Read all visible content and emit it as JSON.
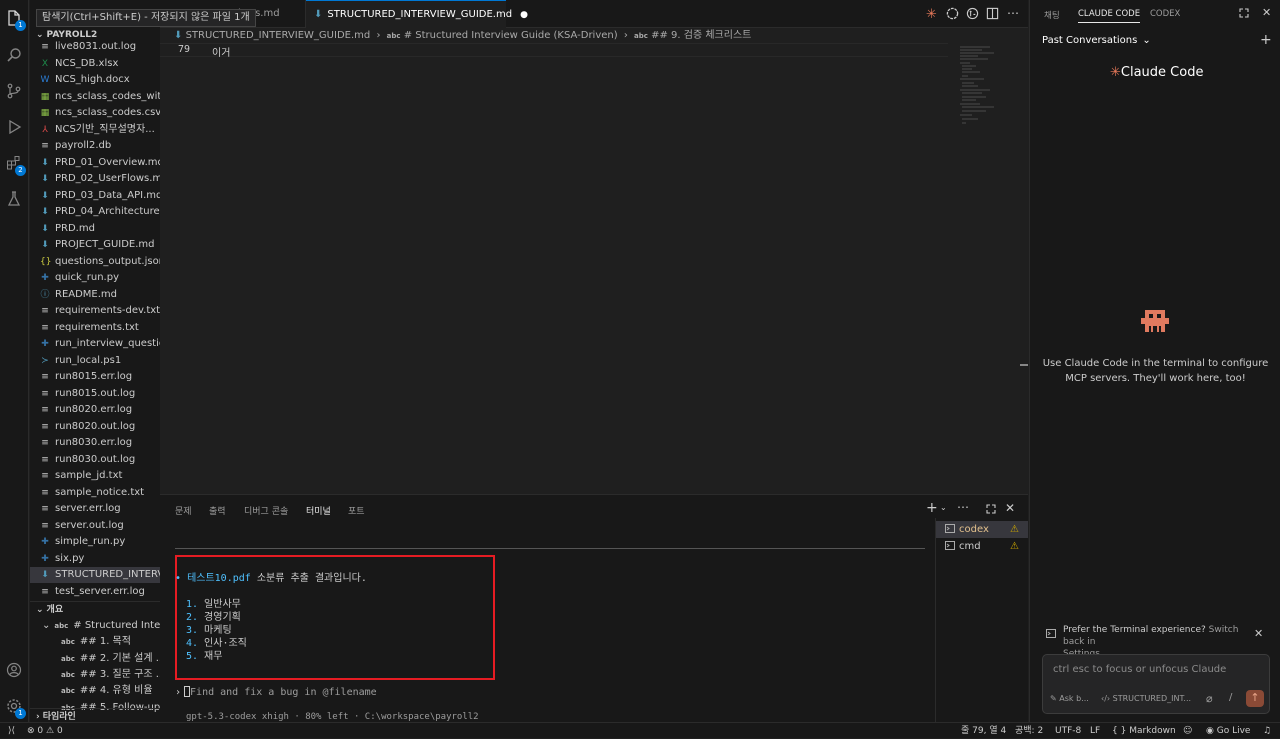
{
  "tooltip": "탐색기(Ctrl+Shift+E) - 저장되지 않은 파일 1개",
  "activity": {
    "explorer_badge": "1",
    "extensions_badge": "2",
    "settings_badge": "1"
  },
  "sidebar": {
    "root": "PAYROLL2",
    "files": [
      {
        "name": "live8031.out.log",
        "icon": "≡",
        "color": "#cccccc"
      },
      {
        "name": "NCS_DB.xlsx",
        "icon": "X",
        "color": "#1d8a4a"
      },
      {
        "name": "NCS_high.docx",
        "icon": "W",
        "color": "#2b7cd3"
      },
      {
        "name": "ncs_sclass_codes_with...",
        "icon": "▦",
        "color": "#8dc149"
      },
      {
        "name": "ncs_sclass_codes.csv",
        "icon": "▦",
        "color": "#8dc149"
      },
      {
        "name": "NCS기반_직무설명자...",
        "icon": "⅄",
        "color": "#e34c4c"
      },
      {
        "name": "payroll2.db",
        "icon": "≡",
        "color": "#cccccc"
      },
      {
        "name": "PRD_01_Overview.md",
        "icon": "⬇",
        "color": "#519aba"
      },
      {
        "name": "PRD_02_UserFlows.md",
        "icon": "⬇",
        "color": "#519aba"
      },
      {
        "name": "PRD_03_Data_API.md",
        "icon": "⬇",
        "color": "#519aba"
      },
      {
        "name": "PRD_04_Architecture....",
        "icon": "⬇",
        "color": "#519aba"
      },
      {
        "name": "PRD.md",
        "icon": "⬇",
        "color": "#519aba"
      },
      {
        "name": "PROJECT_GUIDE.md",
        "icon": "⬇",
        "color": "#519aba"
      },
      {
        "name": "questions_output.json",
        "icon": "{}",
        "color": "#cbcb41"
      },
      {
        "name": "quick_run.py",
        "icon": "✚",
        "color": "#3572a5"
      },
      {
        "name": "README.md",
        "icon": "ⓘ",
        "color": "#519aba"
      },
      {
        "name": "requirements-dev.txt",
        "icon": "≡",
        "color": "#cccccc"
      },
      {
        "name": "requirements.txt",
        "icon": "≡",
        "color": "#cccccc"
      },
      {
        "name": "run_interview_questio...",
        "icon": "✚",
        "color": "#3572a5"
      },
      {
        "name": "run_local.ps1",
        "icon": "≻",
        "color": "#519aba"
      },
      {
        "name": "run8015.err.log",
        "icon": "≡",
        "color": "#cccccc"
      },
      {
        "name": "run8015.out.log",
        "icon": "≡",
        "color": "#cccccc"
      },
      {
        "name": "run8020.err.log",
        "icon": "≡",
        "color": "#cccccc"
      },
      {
        "name": "run8020.out.log",
        "icon": "≡",
        "color": "#cccccc"
      },
      {
        "name": "run8030.err.log",
        "icon": "≡",
        "color": "#cccccc"
      },
      {
        "name": "run8030.out.log",
        "icon": "≡",
        "color": "#cccccc"
      },
      {
        "name": "sample_jd.txt",
        "icon": "≡",
        "color": "#cccccc"
      },
      {
        "name": "sample_notice.txt",
        "icon": "≡",
        "color": "#cccccc"
      },
      {
        "name": "server.err.log",
        "icon": "≡",
        "color": "#cccccc"
      },
      {
        "name": "server.out.log",
        "icon": "≡",
        "color": "#cccccc"
      },
      {
        "name": "simple_run.py",
        "icon": "✚",
        "color": "#3572a5"
      },
      {
        "name": "six.py",
        "icon": "✚",
        "color": "#3572a5"
      },
      {
        "name": "STRUCTURED_INTERVI...",
        "icon": "⬇",
        "color": "#519aba",
        "selected": true
      },
      {
        "name": "test_server.err.log",
        "icon": "≡",
        "color": "#cccccc"
      }
    ],
    "outline_title": "개요",
    "outline": [
      {
        "label": "# Structured Interv...",
        "indent": 1
      },
      {
        "label": "## 1. 목적",
        "indent": 2
      },
      {
        "label": "## 2. 기본 설계 ...",
        "indent": 2
      },
      {
        "label": "## 3. 질문 구조 ...",
        "indent": 2
      },
      {
        "label": "## 4. 유형 비율",
        "indent": 2
      },
      {
        "label": "## 5. Follow-up",
        "indent": 2
      }
    ],
    "timeline_title": "타임라인"
  },
  "tabs": {
    "inactive": "erFlows.md",
    "active": "STRUCTURED_INTERVIEW_GUIDE.md"
  },
  "breadcrumb": {
    "file": "STRUCTURED_INTERVIEW_GUIDE.md",
    "h1": "# Structured Interview Guide (KSA-Driven)",
    "h2": "## 9. 검증 체크리스트"
  },
  "editor": {
    "line_number": "79",
    "line_text": "이거"
  },
  "panel": {
    "tabs": [
      "문제",
      "출력",
      "디버그 콘솔",
      "터미널",
      "포트"
    ],
    "active_tab": "터미널"
  },
  "terminal": {
    "result_file": "테스트10.pdf",
    "result_suffix": " 소분류 추출 결과입니다.",
    "items": [
      {
        "num": "1.",
        "text": "일반사무"
      },
      {
        "num": "2.",
        "text": "경영기획"
      },
      {
        "num": "3.",
        "text": "마케팅"
      },
      {
        "num": "4.",
        "text": "인사·조직"
      },
      {
        "num": "5.",
        "text": "재무"
      }
    ],
    "prompt_placeholder": "Find and fix a bug in @filename",
    "status_line": "gpt-5.3-codex xhigh · 80% left · C:\\workspace\\payroll2"
  },
  "terminal_list": [
    {
      "name": "codex",
      "active": true
    },
    {
      "name": "cmd",
      "active": false
    }
  ],
  "right_panel": {
    "tabs": [
      "채팅",
      "CLAUDE CODE",
      "CODEX"
    ],
    "active_tab": "CLAUDE CODE",
    "past_conversations": "Past Conversations",
    "brand": "Claude Code",
    "info_line1": "Use Claude Code in the terminal to configure",
    "info_line2": "MCP servers. They'll work here, too!",
    "prefer_text": "Prefer the Terminal experience?",
    "switch_back": "Switch back in",
    "settings_link": "Settings.",
    "input_placeholder": "ctrl esc to focus or unfocus Claude",
    "ask_label": "Ask b...",
    "file_chip": "STRUCTURED_INT..."
  },
  "status": {
    "errors": "0",
    "warnings": "0",
    "position": "줄 79, 열 4",
    "spaces": "공백: 2",
    "encoding": "UTF-8",
    "eol": "LF",
    "language": "Markdown",
    "golive": "Go Live"
  }
}
